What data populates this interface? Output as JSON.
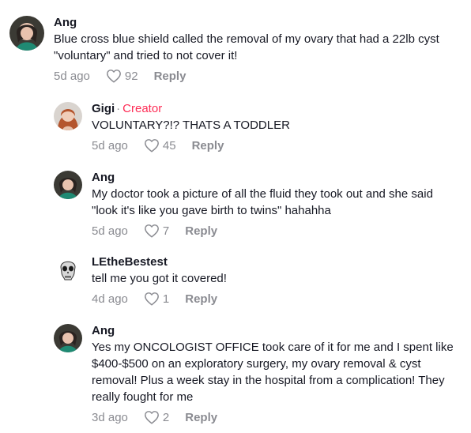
{
  "comments": [
    {
      "author": "Ang",
      "text": "Blue cross blue shield called the removal of my ovary that had a 22lb cyst \"voluntary\" and tried to not cover it!",
      "date": "5d ago",
      "likes": "92",
      "reply_label": "Reply"
    },
    {
      "author": "Gigi",
      "creator_sep": "·",
      "creator_badge": "Creator",
      "text": "VOLUNTARY?!? THATS A TODDLER",
      "date": "5d ago",
      "likes": "45",
      "reply_label": "Reply"
    },
    {
      "author": "Ang",
      "text": "My doctor took a picture of all the fluid they took out and she said \"look it's like you gave birth to twins\" hahahha",
      "date": "5d ago",
      "likes": "7",
      "reply_label": "Reply"
    },
    {
      "author": "LEtheBestest",
      "text": "tell me you got it covered!",
      "date": "4d ago",
      "likes": "1",
      "reply_label": "Reply"
    },
    {
      "author": "Ang",
      "text": "Yes my ONCOLOGIST OFFICE took care of it for me and I spent like $400-$500 on an exploratory surgery, my ovary removal & cyst removal! Plus a week stay in the hospital from a complication! They really fought for me",
      "date": "3d ago",
      "likes": "2",
      "reply_label": "Reply"
    }
  ],
  "colors": {
    "creator": "#fe2c55",
    "meta": "#8a8b91",
    "text": "#161823"
  },
  "icons": {
    "like": "heart-outline-icon"
  }
}
